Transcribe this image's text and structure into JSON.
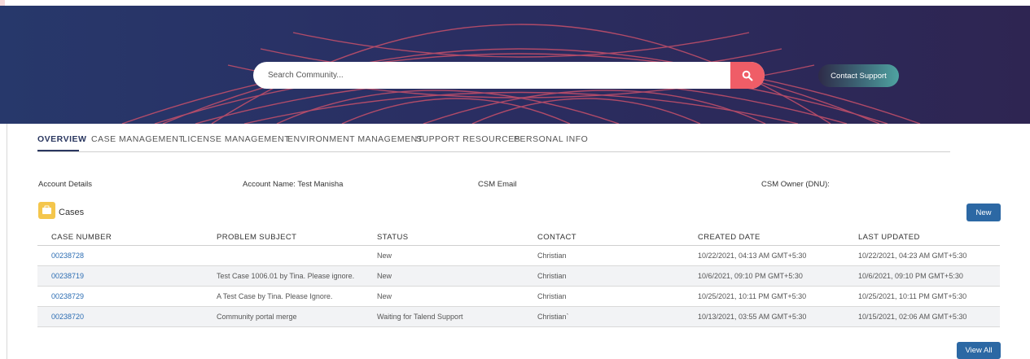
{
  "search": {
    "placeholder": "Search Community...",
    "icon": "search-icon"
  },
  "header": {
    "contact_label": "Contact Support"
  },
  "tabs": [
    {
      "label": "OVERVIEW",
      "active": true
    },
    {
      "label": "CASE MANAGEMENT"
    },
    {
      "label": "LICENSE MANAGEMENT"
    },
    {
      "label": "ENVIRONMENT MANAGEMENT"
    },
    {
      "label": "SUPPORT RESOURCES"
    },
    {
      "label": "PERSONAL INFO"
    }
  ],
  "account": {
    "details_label": "Account Details",
    "name_label": "Account Name: Test Manisha",
    "csm_email_label": "CSM Email",
    "csm_owner_label": "CSM Owner (DNU):"
  },
  "cases": {
    "title": "Cases",
    "new_label": "New",
    "view_all_label": "View All",
    "columns": [
      "CASE NUMBER",
      "PROBLEM SUBJECT",
      "STATUS",
      "CONTACT",
      "CREATED DATE",
      "LAST UPDATED"
    ],
    "rows": [
      [
        "00238728",
        "",
        "New",
        "Christian",
        "10/22/2021, 04:13 AM GMT+5:30",
        "10/22/2021, 04:23 AM GMT+5:30"
      ],
      [
        "00238719",
        "Test Case 1006.01 by Tina. Please ignore.",
        "New",
        "Christian",
        "10/6/2021, 09:10 PM GMT+5:30",
        "10/6/2021, 09:10 PM GMT+5:30"
      ],
      [
        "00238729",
        "A Test Case by Tina. Please Ignore.",
        "New",
        "Christian",
        "10/25/2021, 10:11 PM GMT+5:30",
        "10/25/2021, 10:11 PM GMT+5:30"
      ],
      [
        "00238720",
        "Community portal merge",
        "Waiting for Talend Support",
        "Christian`",
        "10/13/2021, 03:55 AM GMT+5:30",
        "10/15/2021, 02:06 AM GMT+5:30"
      ]
    ]
  },
  "colors": {
    "hero": "#2a2e62",
    "accent": "#ef5d67",
    "primary_button": "#2c68a4",
    "link": "#2c6db3",
    "folder": "#f4c64c"
  }
}
